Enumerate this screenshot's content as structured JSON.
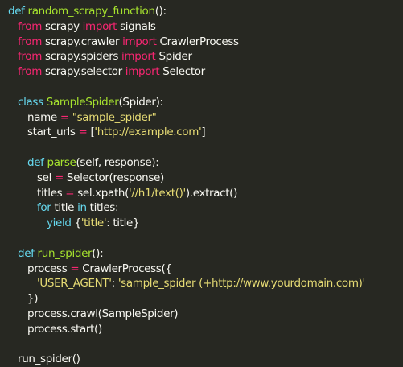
{
  "editor": {
    "colors": {
      "background": "#272822",
      "keyword": "#66d9ef",
      "import_keyword": "#f92672",
      "function_name": "#a6e22e",
      "string": "#e6db74",
      "default_text": "#f8f8f2"
    },
    "lines": [
      {
        "indent": 0,
        "tokens": [
          {
            "type": "kw",
            "text": "def "
          },
          {
            "type": "fn",
            "text": "random_scrapy_function"
          },
          {
            "type": "txt",
            "text": "():"
          }
        ]
      },
      {
        "indent": 1,
        "tokens": [
          {
            "type": "imp",
            "text": "from "
          },
          {
            "type": "txt",
            "text": "scrapy "
          },
          {
            "type": "imp",
            "text": "import "
          },
          {
            "type": "txt",
            "text": "signals"
          }
        ]
      },
      {
        "indent": 1,
        "tokens": [
          {
            "type": "imp",
            "text": "from "
          },
          {
            "type": "txt",
            "text": "scrapy.crawler "
          },
          {
            "type": "imp",
            "text": "import "
          },
          {
            "type": "txt",
            "text": "CrawlerProcess"
          }
        ]
      },
      {
        "indent": 1,
        "tokens": [
          {
            "type": "imp",
            "text": "from "
          },
          {
            "type": "txt",
            "text": "scrapy.spiders "
          },
          {
            "type": "imp",
            "text": "import "
          },
          {
            "type": "txt",
            "text": "Spider"
          }
        ]
      },
      {
        "indent": 1,
        "tokens": [
          {
            "type": "imp",
            "text": "from "
          },
          {
            "type": "txt",
            "text": "scrapy.selector "
          },
          {
            "type": "imp",
            "text": "import "
          },
          {
            "type": "txt",
            "text": "Selector"
          }
        ]
      },
      {
        "indent": 0,
        "tokens": []
      },
      {
        "indent": 1,
        "tokens": [
          {
            "type": "kw",
            "text": "class "
          },
          {
            "type": "fn",
            "text": "SampleSpider"
          },
          {
            "type": "txt",
            "text": "(Spider):"
          }
        ]
      },
      {
        "indent": 2,
        "tokens": [
          {
            "type": "txt",
            "text": "name "
          },
          {
            "type": "op",
            "text": "= "
          },
          {
            "type": "str",
            "text": "\"sample_spider\""
          }
        ]
      },
      {
        "indent": 2,
        "tokens": [
          {
            "type": "txt",
            "text": "start_urls "
          },
          {
            "type": "op",
            "text": "= "
          },
          {
            "type": "txt",
            "text": "["
          },
          {
            "type": "str",
            "text": "'http://example.com'"
          },
          {
            "type": "txt",
            "text": "]"
          }
        ]
      },
      {
        "indent": 0,
        "tokens": []
      },
      {
        "indent": 2,
        "tokens": [
          {
            "type": "kw",
            "text": "def "
          },
          {
            "type": "fn",
            "text": "parse"
          },
          {
            "type": "txt",
            "text": "(self, response):"
          }
        ]
      },
      {
        "indent": 3,
        "tokens": [
          {
            "type": "txt",
            "text": "sel "
          },
          {
            "type": "op",
            "text": "= "
          },
          {
            "type": "txt",
            "text": "Selector(response)"
          }
        ]
      },
      {
        "indent": 3,
        "tokens": [
          {
            "type": "txt",
            "text": "titles "
          },
          {
            "type": "op",
            "text": "= "
          },
          {
            "type": "txt",
            "text": "sel.xpath("
          },
          {
            "type": "str",
            "text": "'//h1/text()'"
          },
          {
            "type": "txt",
            "text": ").extract()"
          }
        ]
      },
      {
        "indent": 3,
        "tokens": [
          {
            "type": "kw",
            "text": "for "
          },
          {
            "type": "txt",
            "text": "title "
          },
          {
            "type": "kw",
            "text": "in "
          },
          {
            "type": "txt",
            "text": "titles:"
          }
        ]
      },
      {
        "indent": 4,
        "tokens": [
          {
            "type": "kw",
            "text": "yield "
          },
          {
            "type": "txt",
            "text": "{"
          },
          {
            "type": "str",
            "text": "'title'"
          },
          {
            "type": "txt",
            "text": ": title}"
          }
        ]
      },
      {
        "indent": 0,
        "tokens": []
      },
      {
        "indent": 1,
        "tokens": [
          {
            "type": "kw",
            "text": "def "
          },
          {
            "type": "fn",
            "text": "run_spider"
          },
          {
            "type": "txt",
            "text": "():"
          }
        ]
      },
      {
        "indent": 2,
        "tokens": [
          {
            "type": "txt",
            "text": "process "
          },
          {
            "type": "op",
            "text": "= "
          },
          {
            "type": "txt",
            "text": "CrawlerProcess({"
          }
        ]
      },
      {
        "indent": 3,
        "tokens": [
          {
            "type": "str",
            "text": "'USER_AGENT'"
          },
          {
            "type": "txt",
            "text": ": "
          },
          {
            "type": "str",
            "text": "'sample_spider (+http://www.yourdomain.com)'"
          }
        ]
      },
      {
        "indent": 2,
        "tokens": [
          {
            "type": "txt",
            "text": "})"
          }
        ]
      },
      {
        "indent": 2,
        "tokens": [
          {
            "type": "txt",
            "text": "process.crawl(SampleSpider)"
          }
        ]
      },
      {
        "indent": 2,
        "tokens": [
          {
            "type": "txt",
            "text": "process.start()"
          }
        ]
      },
      {
        "indent": 0,
        "tokens": []
      },
      {
        "indent": 1,
        "tokens": [
          {
            "type": "txt",
            "text": "run_spider()"
          }
        ]
      }
    ]
  }
}
